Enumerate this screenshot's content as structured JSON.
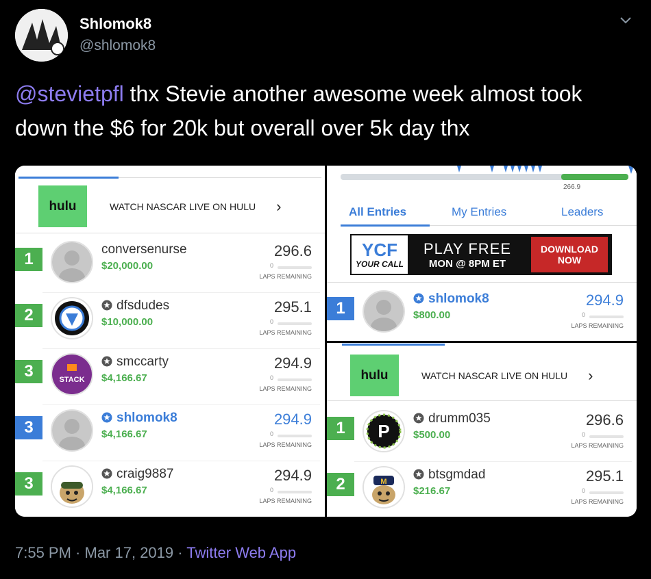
{
  "author": {
    "name": "Shlomok8",
    "handle": "@shlomok8"
  },
  "tweet": {
    "mention": "@stevietpfl",
    "text": " thx Stevie another awesome week almost took down the $6 for 20k but overall over 5k day thx"
  },
  "footer": {
    "time": "7:55 PM",
    "sep1": " · ",
    "date": "Mar 17, 2019",
    "sep2": " · ",
    "app": "Twitter Web App"
  },
  "left_panel": {
    "ad": {
      "brand": "hulu",
      "text": "WATCH NASCAR LIVE ON HULU",
      "arrow": "›"
    },
    "laps_label": "LAPS REMAINING",
    "laps_value": "0",
    "rows": [
      {
        "rank": "1",
        "rank_color": "green",
        "name": "conversenurse",
        "prize": "$20,000.00",
        "score": "296.6",
        "starred": false,
        "me": false
      },
      {
        "rank": "2",
        "rank_color": "green",
        "name": "dfsdudes",
        "prize": "$10,000.00",
        "score": "295.1",
        "starred": true,
        "me": false
      },
      {
        "rank": "3",
        "rank_color": "green",
        "name": "smccarty",
        "prize": "$4,166.67",
        "score": "294.9",
        "starred": true,
        "me": false
      },
      {
        "rank": "3",
        "rank_color": "blue",
        "name": "shlomok8",
        "prize": "$4,166.67",
        "score": "294.9",
        "starred": true,
        "me": true
      },
      {
        "rank": "3",
        "rank_color": "green",
        "name": "craig9887",
        "prize": "$4,166.67",
        "score": "294.9",
        "starred": true,
        "me": false
      }
    ]
  },
  "right_top": {
    "progress_value": "266.9",
    "tabs": [
      "All Entries",
      "My Entries",
      "Leaders"
    ],
    "banner": {
      "logo": "YOUR CALL",
      "title": "PLAY FREE",
      "sub": "MON @ 8PM ET",
      "cta": "DOWNLOAD NOW"
    },
    "row": {
      "rank": "1",
      "name": "shlomok8",
      "prize": "$800.00",
      "score": "294.9"
    }
  },
  "right_bottom": {
    "ad": {
      "brand": "hulu",
      "text": "WATCH NASCAR LIVE ON HULU",
      "arrow": "›"
    },
    "rows": [
      {
        "rank": "1",
        "name": "drumm035",
        "prize": "$500.00",
        "score": "296.6"
      },
      {
        "rank": "2",
        "name": "btsgmdad",
        "prize": "$216.67",
        "score": "295.1"
      }
    ]
  },
  "colors": {
    "accent": "#8d7cf0",
    "green": "#4caf50",
    "blue": "#3b7dd8",
    "muted": "#8b98a5"
  }
}
